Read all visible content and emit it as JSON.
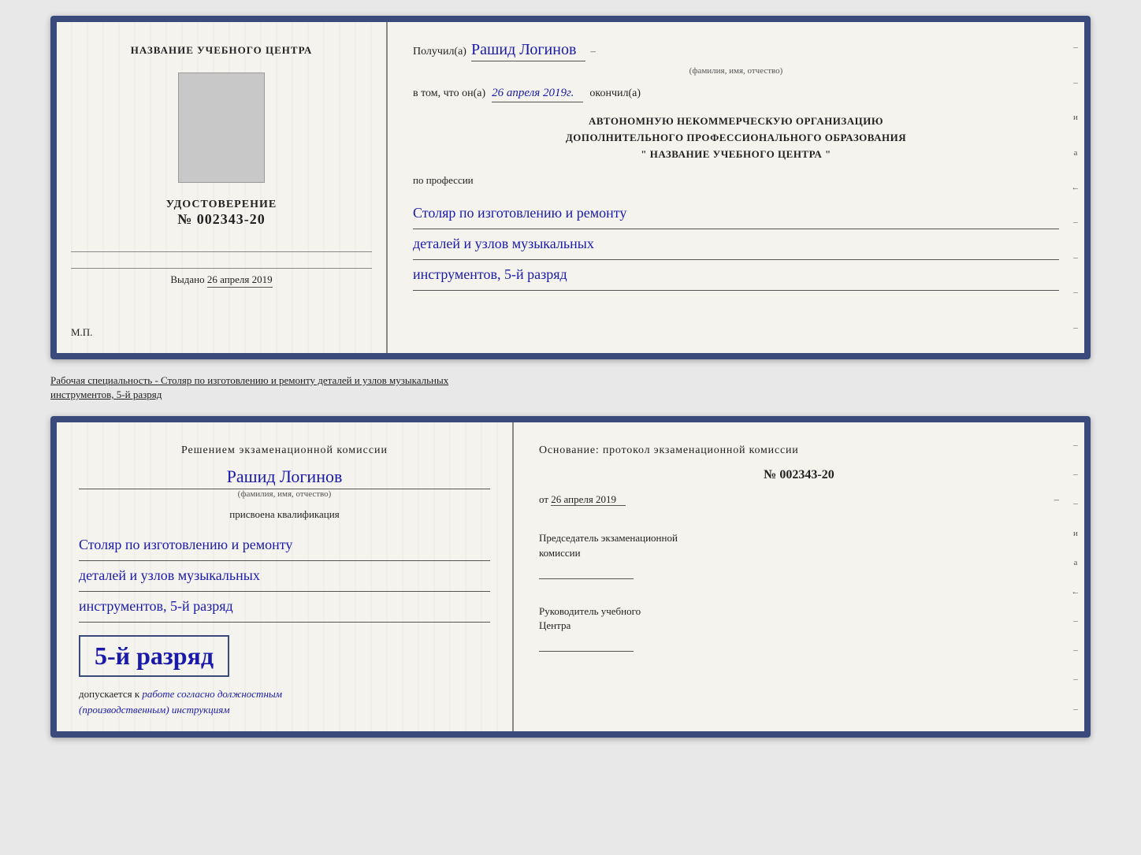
{
  "cert_top": {
    "left": {
      "title": "НАЗВАНИЕ УЧЕБНОГО ЦЕНТРА",
      "udostoverenie_label": "УДОСТОВЕРЕНИЕ",
      "number": "№ 002343-20",
      "vydano_label": "Выдано",
      "vydano_date": "26 апреля 2019",
      "mp": "М.П."
    },
    "right": {
      "poluchil": "Получил(а)",
      "name": "Рашид Логинов",
      "fio_hint": "(фамилия, имя, отчество)",
      "v_tom": "в том, что он(а)",
      "date_val": "26 апреля 2019г.",
      "okonchil": "окончил(а)",
      "org_line1": "АВТОНОМНУЮ НЕКОММЕРЧЕСКУЮ ОРГАНИЗАЦИЮ",
      "org_line2": "ДОПОЛНИТЕЛЬНОГО ПРОФЕССИОНАЛЬНОГО ОБРАЗОВАНИЯ",
      "org_line3": "\"  НАЗВАНИЕ УЧЕБНОГО ЦЕНТРА  \"",
      "po_professii": "по профессии",
      "profession_line1": "Столяр по изготовлению и ремонту",
      "profession_line2": "деталей и узлов музыкальных",
      "profession_line3": "инструментов, 5-й разряд"
    },
    "side_chars": [
      "–",
      "–",
      "и",
      "а",
      "←",
      "–",
      "–",
      "–",
      "–"
    ]
  },
  "middle_label": {
    "text_before": "Рабочая специальность - Столяр по изготовлению и ремонту деталей и узлов музыкальных",
    "text_underline": "инструментов, 5-й разряд"
  },
  "cert_bottom": {
    "left": {
      "resheniyem": "Решением экзаменационной комиссии",
      "name": "Рашид Логинов",
      "fio_hint": "(фамилия, имя, отчество)",
      "prisvoena": "присвоена квалификация",
      "prof_line1": "Столяр по изготовлению и ремонту",
      "prof_line2": "деталей и узлов музыкальных",
      "prof_line3": "инструментов, 5-й разряд",
      "razryad_text": "5-й разряд",
      "dopuskaetsya": "допускается к",
      "dopusk_italic1": "работе согласно должностным",
      "dopusk_italic2": "(производственным) инструкциям"
    },
    "right": {
      "osnovanie": "Основание: протокол экзаменационной  комиссии",
      "number": "№  002343-20",
      "ot_label": "от",
      "ot_date": "26 апреля 2019",
      "predsedatel_label": "Председатель экзаменационной",
      "predsedatel_label2": "комиссии",
      "rukovoditel_label": "Руководитель учебного",
      "rukovoditel_label2": "Центра"
    },
    "side_chars": [
      "–",
      "–",
      "–",
      "и",
      "а",
      "←",
      "–",
      "–",
      "–",
      "–"
    ]
  }
}
